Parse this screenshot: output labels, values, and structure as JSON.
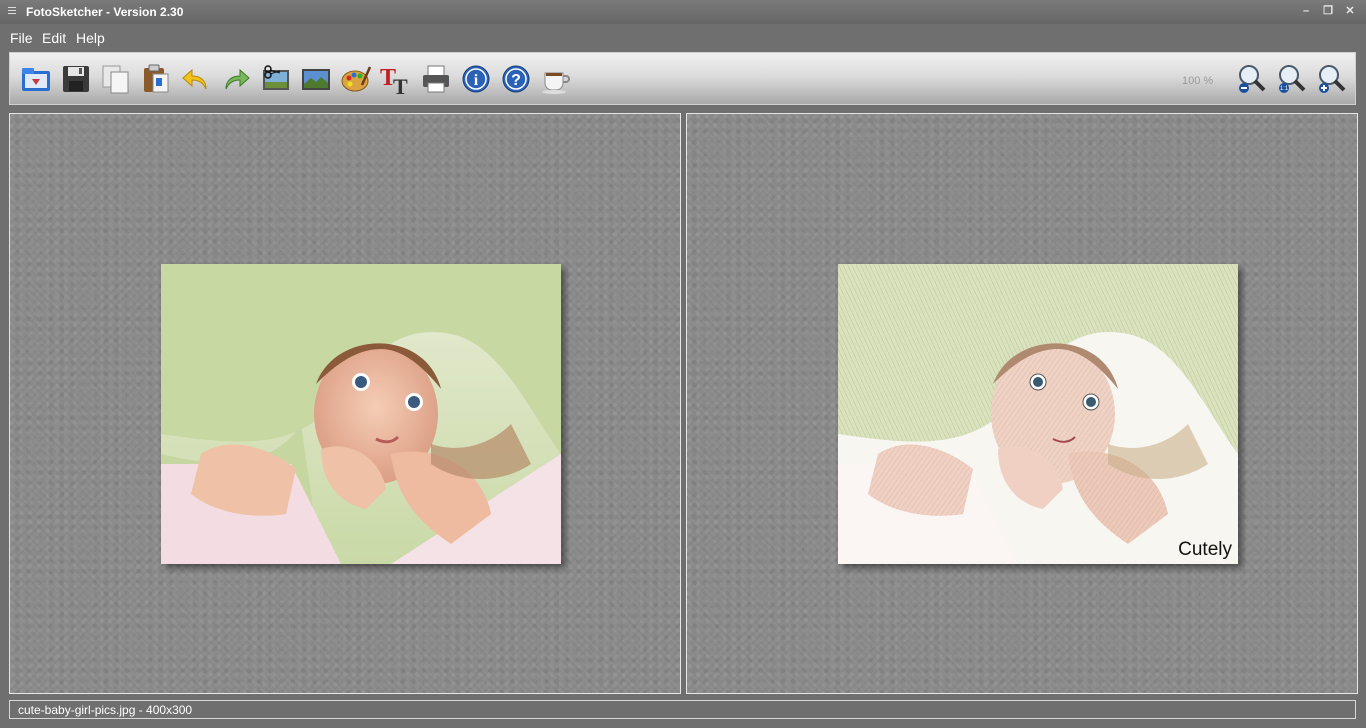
{
  "window": {
    "title": "FotoSketcher - Version 2.30",
    "controls": [
      "minimize",
      "restore",
      "close"
    ]
  },
  "menu": {
    "items": [
      {
        "label": "File"
      },
      {
        "label": "Edit"
      },
      {
        "label": "Help"
      }
    ]
  },
  "toolbar": {
    "icons": [
      "open-folder-icon",
      "save-icon",
      "copy-icon",
      "paste-icon",
      "undo-icon",
      "redo-icon",
      "crop-image-icon",
      "landscape-image-icon",
      "palette-icon",
      "text-icon",
      "print-icon",
      "info-icon",
      "help-icon",
      "coffee-cup-icon"
    ],
    "zoom_level": "100 %",
    "zoom_icons": [
      "zoom-out-icon",
      "zoom-fit-icon",
      "zoom-in-icon"
    ]
  },
  "right_panel": {
    "watermark": "Cutely"
  },
  "statusbar": {
    "text": "cute-baby-girl-pics.jpg - 400x300"
  },
  "colors": {
    "window_bg": "#6f6f6f",
    "panel_bg": "#8a8a8a",
    "toolbar_top": "#f0f0f0",
    "toolbar_bottom": "#a9a9a9"
  }
}
